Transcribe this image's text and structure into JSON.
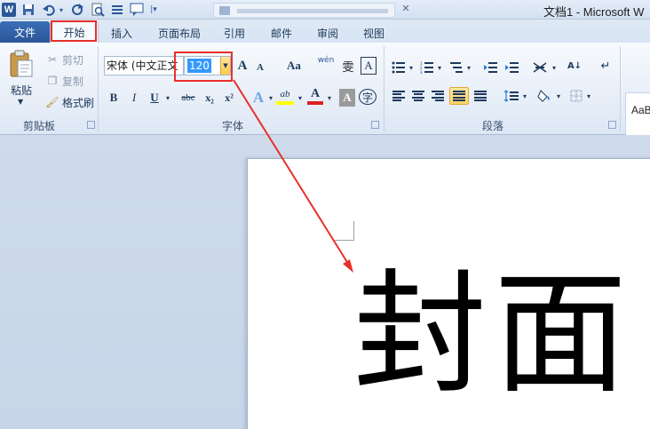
{
  "window": {
    "title": "文档1 - Microsoft W",
    "app_icon_letter": "W"
  },
  "quick_access": {
    "items": [
      "save-icon",
      "undo-icon",
      "redo-icon",
      "print-preview-icon",
      "list-icon",
      "comment-icon",
      "customize-icon"
    ]
  },
  "tabs": {
    "file": "文件",
    "home": "开始",
    "insert": "插入",
    "page_layout": "页面布局",
    "references": "引用",
    "mailings": "邮件",
    "review": "审阅",
    "view": "视图"
  },
  "clipboard": {
    "paste": "粘贴",
    "cut": "剪切",
    "copy": "复制",
    "format_painter": "格式刷",
    "group_label": "剪贴板"
  },
  "font": {
    "name": "宋体 (中文正文",
    "size": "120",
    "group_label": "字体",
    "grow_label": "A",
    "shrink_label": "A",
    "change_case_label": "Aa",
    "pinyin_label": "wén",
    "pinyin_char": "雯",
    "border_char_label": "A",
    "bold": "B",
    "italic": "I",
    "underline": "U",
    "strike": "abc",
    "subscript": "x₂",
    "superscript": "x²",
    "effects_label": "A",
    "highlight_label": "ab",
    "color_label": "A",
    "shading_label": "A",
    "enclose_label": "字"
  },
  "paragraph": {
    "group_label": "段落"
  },
  "styles": {
    "sample": "AaBb"
  },
  "document": {
    "cover_text": "封面"
  },
  "annotation": {
    "highlight_color": "#e8302c"
  }
}
